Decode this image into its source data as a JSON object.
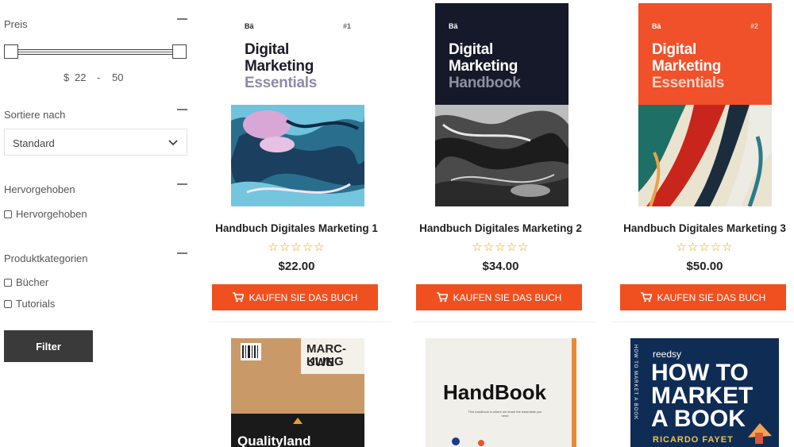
{
  "sidebar": {
    "price_title": "Preis",
    "price_currency": "$",
    "price_min": "22",
    "price_sep": "-",
    "price_max": "50",
    "sort_title": "Sortiere nach",
    "sort_value": "Standard",
    "featured_title": "Hervorgehoben",
    "featured_option": "Hervorgehoben",
    "categories_title": "Produktkategorien",
    "categories": [
      "Bücher",
      "Tutorials"
    ],
    "filter_label": "Filter"
  },
  "products": [
    {
      "name": "Handbuch Digitales Marketing 1",
      "stars": "☆☆☆☆☆",
      "price": "$22.00",
      "button": "KAUFEN SIE DAS BUCH",
      "cover": {
        "brand": "Bä",
        "number": "#1",
        "line1": "Digital",
        "line2": "Marketing",
        "line3": "Essentials"
      }
    },
    {
      "name": "Handbuch Digitales Marketing 2",
      "stars": "☆☆☆☆☆",
      "price": "$34.00",
      "button": "KAUFEN SIE DAS BUCH",
      "cover": {
        "brand": "Bä",
        "number": "",
        "line1": "Digital",
        "line2": "Marketing",
        "line3": "Handbook"
      }
    },
    {
      "name": "Handbuch Digitales Marketing 3",
      "stars": "☆☆☆☆☆",
      "price": "$50.00",
      "button": "KAUFEN SIE DAS BUCH",
      "cover": {
        "brand": "Bä",
        "number": "#2",
        "line1": "Digital",
        "line2": "Marketing",
        "line3": "Essentials"
      }
    }
  ],
  "row2": [
    {
      "line1": "MARC-UWE",
      "line2": "KLING",
      "bottom": "Qualityland"
    },
    {
      "title": "HandBook",
      "sub": "This handbook is where we share the essentials you need"
    },
    {
      "brand": "reedsy",
      "line1": "HOW TO",
      "line2": "MARKET",
      "line3": "A BOOK",
      "author": "RICARDO FAYET",
      "spine": "HOW TO MARKET A BOOK"
    }
  ],
  "colors": {
    "accent": "#f0501f",
    "stars": "#e6a400",
    "filter_btn": "#3a3a3a"
  }
}
